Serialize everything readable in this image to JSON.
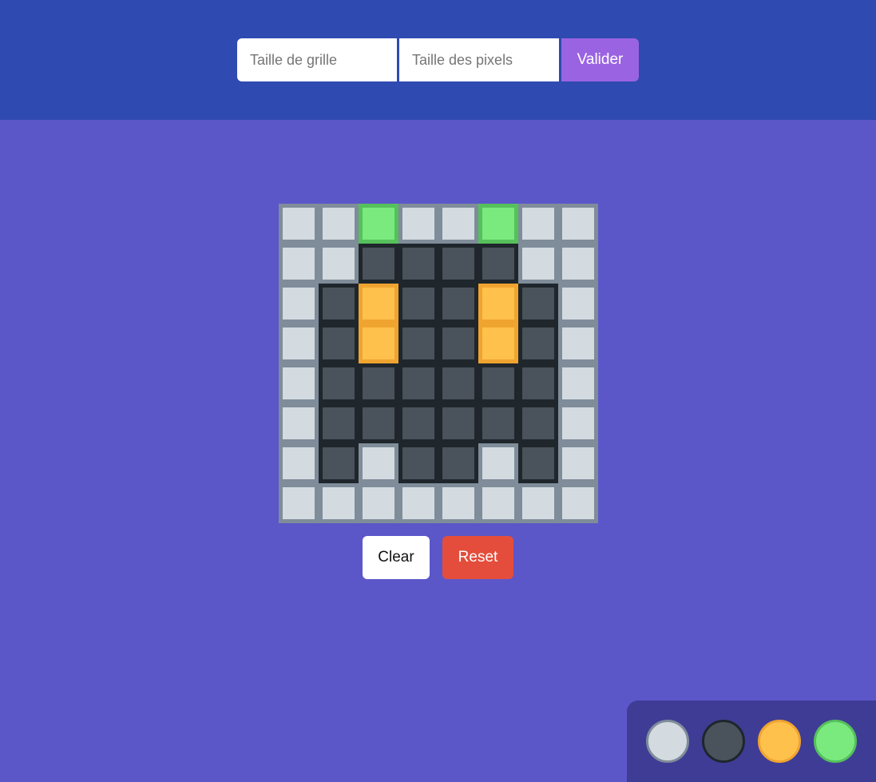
{
  "form": {
    "grid_size_placeholder": "Taille de grille",
    "pixel_size_placeholder": "Taille des pixels",
    "submit_label": "Valider"
  },
  "colors": {
    "header_bg": "#2f4ab0",
    "page_bg": "#5b57c9",
    "submit_bg": "#9a63e2",
    "reset_bg": "#e44d3c",
    "palette_bg": "#3f3c96"
  },
  "palette": [
    {
      "name": "light-gray",
      "fill": "#d3dbe1",
      "border": "#7f8c99"
    },
    {
      "name": "dark-slate",
      "fill": "#4a525b",
      "border": "#1f262c"
    },
    {
      "name": "orange",
      "fill": "#fdc14c",
      "border": "#f0a430"
    },
    {
      "name": "green",
      "fill": "#7bea7e",
      "border": "#55c05c"
    }
  ],
  "grid": {
    "size": 8,
    "cells": [
      [
        0,
        0,
        3,
        0,
        0,
        3,
        0,
        0
      ],
      [
        0,
        0,
        1,
        1,
        1,
        1,
        0,
        0
      ],
      [
        0,
        1,
        2,
        1,
        1,
        2,
        1,
        0
      ],
      [
        0,
        1,
        2,
        1,
        1,
        2,
        1,
        0
      ],
      [
        0,
        1,
        1,
        1,
        1,
        1,
        1,
        0
      ],
      [
        0,
        1,
        1,
        1,
        1,
        1,
        1,
        0
      ],
      [
        0,
        1,
        0,
        1,
        1,
        0,
        1,
        0
      ],
      [
        0,
        0,
        0,
        0,
        0,
        0,
        0,
        0
      ]
    ]
  },
  "actions": {
    "clear_label": "Clear",
    "reset_label": "Reset"
  }
}
